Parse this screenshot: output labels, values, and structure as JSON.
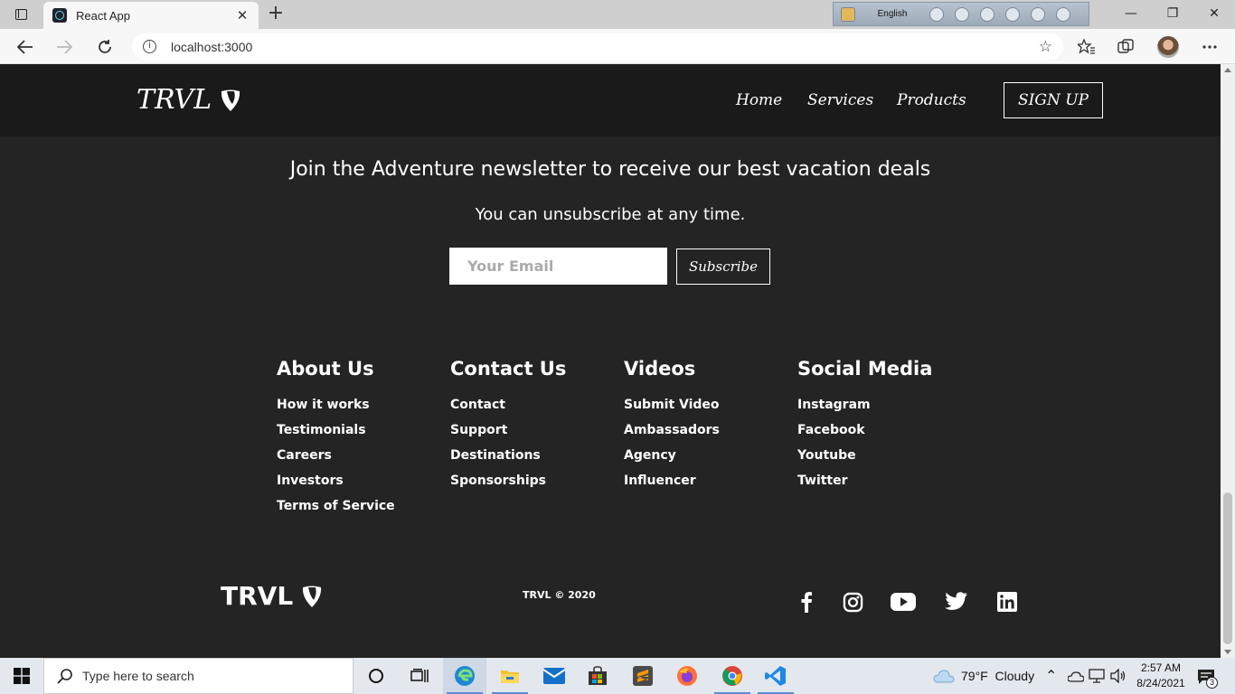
{
  "browser": {
    "tab_title": "React App",
    "tab_close": "✕",
    "new_tab": "+",
    "url": "localhost:3000",
    "language": "English",
    "window_controls": [
      "—",
      "❐",
      "✕"
    ]
  },
  "site": {
    "logo_text": "TRVL",
    "nav": {
      "home": "Home",
      "services": "Services",
      "products": "Products",
      "signup": "SIGN UP"
    },
    "newsletter": {
      "heading": "Join the Adventure newsletter to receive our best vacation deals",
      "subheading": "You can unsubscribe at any time.",
      "email_placeholder": "Your Email",
      "subscribe_label": "Subscribe"
    },
    "footer_columns": [
      {
        "title": "About Us",
        "links": [
          "How it works",
          "Testimonials",
          "Careers",
          "Investors",
          "Terms of Service"
        ]
      },
      {
        "title": "Contact Us",
        "links": [
          "Contact",
          "Support",
          "Destinations",
          "Sponsorships"
        ]
      },
      {
        "title": "Videos",
        "links": [
          "Submit Video",
          "Ambassadors",
          "Agency",
          "Influencer"
        ]
      },
      {
        "title": "Social Media",
        "links": [
          "Instagram",
          "Facebook",
          "Youtube",
          "Twitter"
        ]
      }
    ],
    "footer_logo": "TRVL",
    "copyright": "TRVL © 2020",
    "social_icons": [
      "facebook-icon",
      "instagram-icon",
      "youtube-icon",
      "twitter-icon",
      "linkedin-icon"
    ]
  },
  "taskbar": {
    "search_placeholder": "Type here to search",
    "weather": "79°F  Cloudy",
    "time": "2:57 AM",
    "date": "8/24/2021",
    "notification_count": "3"
  },
  "colors": {
    "page_bg": "#242424",
    "navbar_bg": "#1a1a1a",
    "text": "#ffffff"
  }
}
